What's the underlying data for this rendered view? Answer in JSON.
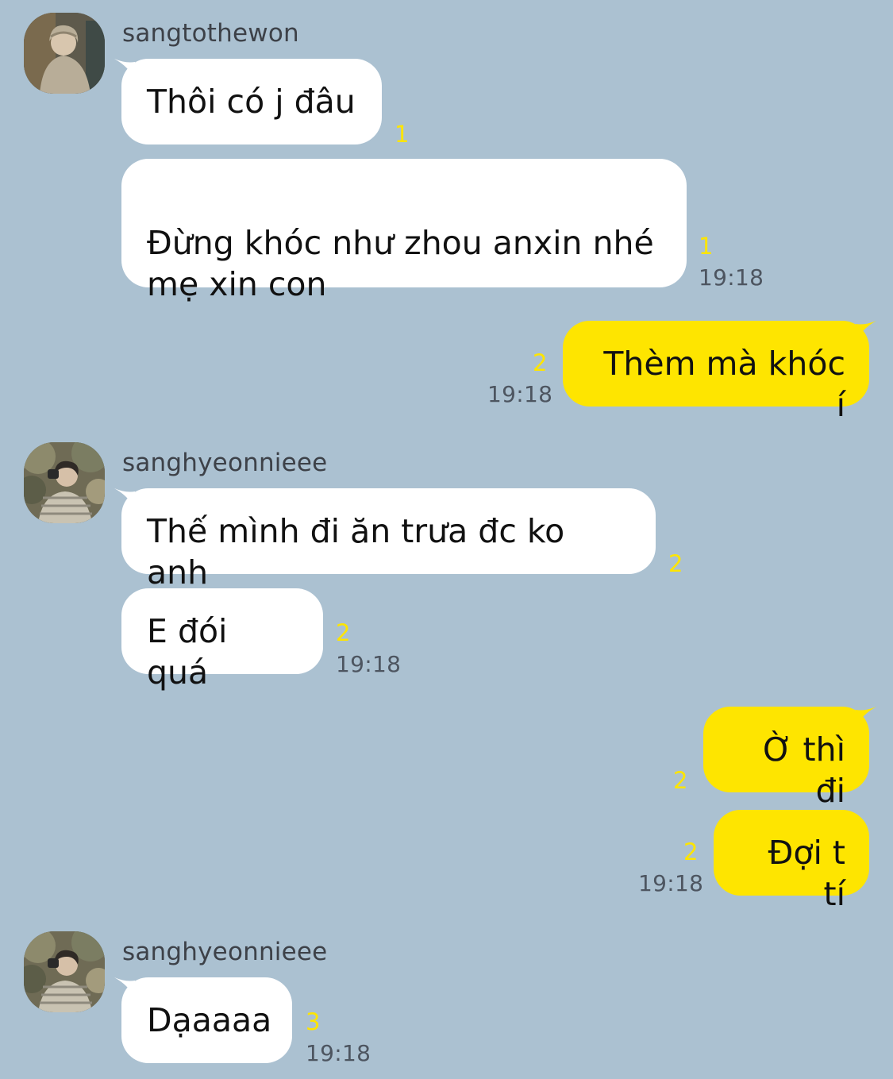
{
  "colors": {
    "background": "#abc1d1",
    "incoming_bubble": "#ffffff",
    "outgoing_bubble": "#fee500",
    "unread_count": "#fee500",
    "timestamp": "#4d5560"
  },
  "groups": [
    {
      "sender": "sangtothewon",
      "avatar": "profile-photo-avatar",
      "messages": [
        {
          "text": "Thôi có j đâu",
          "unread": "1",
          "time": ""
        },
        {
          "text": "Đừng khóc như zhou anxin nhé\nmẹ xin con",
          "unread": "1",
          "time": "19:18"
        }
      ]
    },
    {
      "outgoing": true,
      "messages": [
        {
          "text": "Thèm mà khóc í",
          "unread": "2",
          "time": "19:18"
        }
      ]
    },
    {
      "sender": "sanghyeonnieee",
      "avatar": "profile-photo-avatar",
      "messages": [
        {
          "text": "Thế mình đi ăn trưa đc ko anh",
          "unread": "2",
          "time": ""
        },
        {
          "text": "E đói quá",
          "unread": "2",
          "time": "19:18"
        }
      ]
    },
    {
      "outgoing": true,
      "messages": [
        {
          "text": "Ờ thì đi",
          "unread": "2",
          "time": ""
        },
        {
          "text": "Đợi t tí",
          "unread": "2",
          "time": "19:18"
        }
      ]
    },
    {
      "sender": "sanghyeonnieee",
      "avatar": "profile-photo-avatar",
      "messages": [
        {
          "text": "Dạaaaa",
          "unread": "3",
          "time": "19:18"
        }
      ]
    }
  ]
}
